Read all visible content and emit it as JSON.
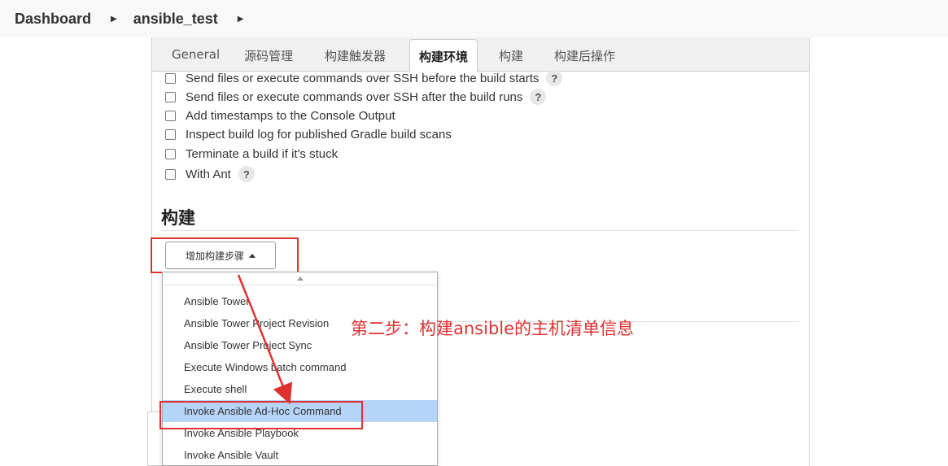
{
  "breadcrumb": {
    "items": [
      "Dashboard",
      "ansible_test"
    ]
  },
  "tabs": [
    {
      "label": "General",
      "active": false
    },
    {
      "label": "源码管理",
      "active": false
    },
    {
      "label": "构建触发器",
      "active": false
    },
    {
      "label": "构建环境",
      "active": true
    },
    {
      "label": "构建",
      "active": false
    },
    {
      "label": "构建后操作",
      "active": false
    }
  ],
  "build_env_options": [
    {
      "label": "Send files or execute commands over SSH before the build starts",
      "help": "?",
      "checked": false
    },
    {
      "label": "Send files or execute commands over SSH after the build runs",
      "help": "?",
      "checked": false
    },
    {
      "label": "Add timestamps to the Console Output",
      "checked": false
    },
    {
      "label": "Inspect build log for published Gradle build scans",
      "checked": false
    },
    {
      "label": "Terminate a build if it's stuck",
      "checked": false
    },
    {
      "label": "With Ant",
      "help": "?",
      "checked": false
    }
  ],
  "build_section": {
    "title": "构建",
    "add_step_label": "增加构建步骤"
  },
  "dropdown": {
    "items": [
      "Ansible Tower",
      "Ansible Tower Project Revision",
      "Ansible Tower Project Sync",
      "Execute Windows batch command",
      "Execute shell",
      "Invoke Ansible Ad-Hoc Command",
      "Invoke Ansible Playbook",
      "Invoke Ansible Vault"
    ],
    "highlighted": "Invoke Ansible Ad-Hoc Command"
  },
  "annotation": {
    "text": "第二步：构建ansible的主机清单信息",
    "color": "#e03131"
  },
  "colors": {
    "highlight": "#b6d4f8",
    "annotation_red": "#e03131"
  }
}
